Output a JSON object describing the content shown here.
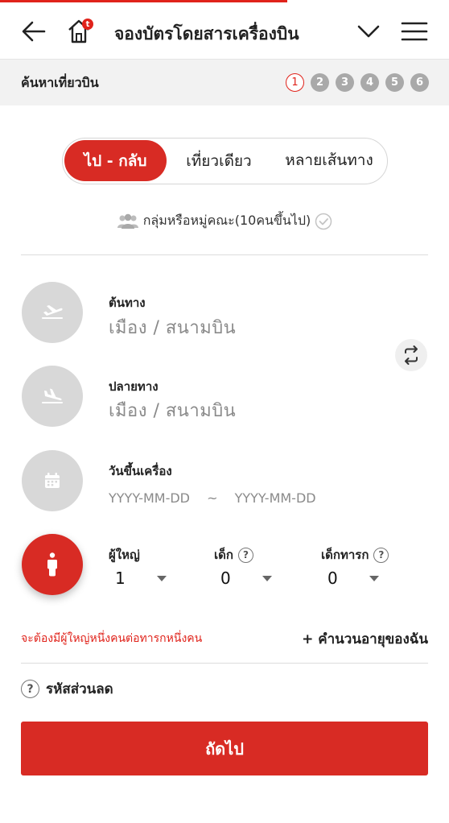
{
  "header": {
    "title": "จองบัตรโดยสารเครื่องบิน",
    "home_badge": "t",
    "icons": [
      "arrow-left-icon",
      "home-icon",
      "chevron-down-icon",
      "hamburger-menu-icon"
    ]
  },
  "stepbar": {
    "title": "ค้นหาเที่ยวบิน",
    "steps": [
      "1",
      "2",
      "3",
      "4",
      "5",
      "6"
    ],
    "active_step": 1
  },
  "trip_type": {
    "options": [
      "ไป - กลับ",
      "เที่ยวเดียว",
      "หลายเส้นทาง"
    ],
    "selected": "ไป - กลับ"
  },
  "group_booking": {
    "label": "กลุ่มหรือหมู่คณะ(10คนขึ้นไป)"
  },
  "origin": {
    "label": "ต้นทาง",
    "placeholder": "เมือง / สนามบิน"
  },
  "destination": {
    "label": "ปลายทาง",
    "placeholder": "เมือง / สนามบิน"
  },
  "dates": {
    "label": "วันขึ้นเครื่อง",
    "depart": "YYYY-MM-DD",
    "separator": "~",
    "return": "YYYY-MM-DD"
  },
  "passengers": {
    "adult": {
      "label": "ผู้ใหญ่",
      "value": "1"
    },
    "child": {
      "label": "เด็ก",
      "value": "0"
    },
    "infant": {
      "label": "เด็กทารก",
      "value": "0"
    },
    "help_glyph": "?"
  },
  "warning": "จะต้องมีผู้ใหญ่หนึ่งคนต่อทารกหนึ่งคน",
  "age_calculator": "+ คำนวนอายุของฉัน",
  "promo_code": {
    "label": "รหัสส่วนลด"
  },
  "next_button": "ถัดไป",
  "colors": {
    "brand_red": "#d82b24",
    "accent_red": "#e0231b",
    "disabled_gray": "#d8d8d8"
  }
}
